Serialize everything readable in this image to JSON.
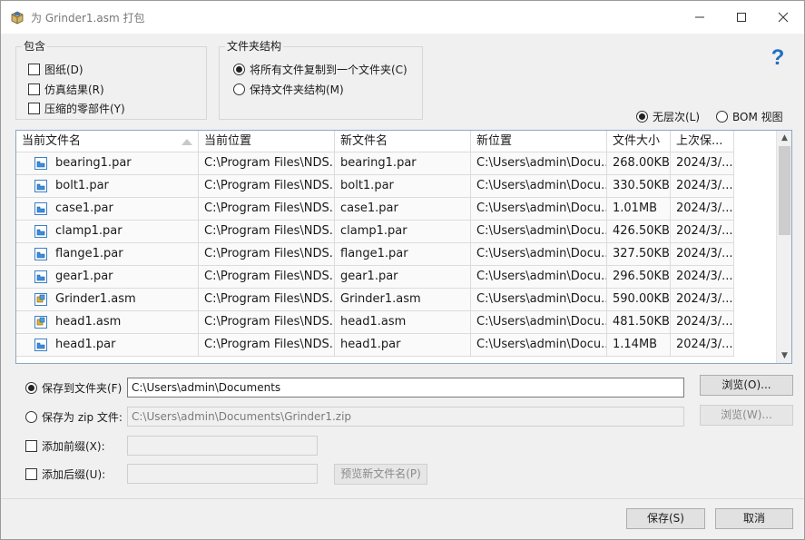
{
  "window": {
    "title": "为 Grinder1.asm 打包",
    "controls": {
      "minimize": "minimize-icon",
      "maximize": "maximize-icon",
      "close": "close-icon"
    }
  },
  "include": {
    "title": "包含",
    "options": [
      {
        "label": "图纸(D)",
        "checked": false
      },
      {
        "label": "仿真结果(R)",
        "checked": false
      },
      {
        "label": "压缩的零部件(Y)",
        "checked": false
      }
    ]
  },
  "folder_structure": {
    "title": "文件夹结构",
    "options": [
      {
        "label": "将所有文件复制到一个文件夹(C)",
        "selected": true
      },
      {
        "label": "保持文件夹结构(M)",
        "selected": false
      }
    ]
  },
  "view_mode": {
    "options": [
      {
        "label": "无层次(L)",
        "selected": true
      },
      {
        "label": "BOM 视图",
        "selected": false
      }
    ]
  },
  "table": {
    "columns": [
      "当前文件名",
      "当前位置",
      "新文件名",
      "新位置",
      "文件大小",
      "上次保..."
    ],
    "rows": [
      {
        "name": "bearing1.par",
        "type": "part",
        "location": "C:\\Program Files\\NDS...",
        "new_name": "bearing1.par",
        "new_location": "C:\\Users\\admin\\Docu...",
        "size": "268.00KB",
        "saved": "2024/3/..."
      },
      {
        "name": "bolt1.par",
        "type": "part",
        "location": "C:\\Program Files\\NDS...",
        "new_name": "bolt1.par",
        "new_location": "C:\\Users\\admin\\Docu...",
        "size": "330.50KB",
        "saved": "2024/3/..."
      },
      {
        "name": "case1.par",
        "type": "part",
        "location": "C:\\Program Files\\NDS...",
        "new_name": "case1.par",
        "new_location": "C:\\Users\\admin\\Docu...",
        "size": "1.01MB",
        "saved": "2024/3/..."
      },
      {
        "name": "clamp1.par",
        "type": "part",
        "location": "C:\\Program Files\\NDS...",
        "new_name": "clamp1.par",
        "new_location": "C:\\Users\\admin\\Docu...",
        "size": "426.50KB",
        "saved": "2024/3/..."
      },
      {
        "name": "flange1.par",
        "type": "part",
        "location": "C:\\Program Files\\NDS...",
        "new_name": "flange1.par",
        "new_location": "C:\\Users\\admin\\Docu...",
        "size": "327.50KB",
        "saved": "2024/3/..."
      },
      {
        "name": "gear1.par",
        "type": "part",
        "location": "C:\\Program Files\\NDS...",
        "new_name": "gear1.par",
        "new_location": "C:\\Users\\admin\\Docu...",
        "size": "296.50KB",
        "saved": "2024/3/..."
      },
      {
        "name": "Grinder1.asm",
        "type": "assembly",
        "location": "C:\\Program Files\\NDS...",
        "new_name": "Grinder1.asm",
        "new_location": "C:\\Users\\admin\\Docu...",
        "size": "590.00KB",
        "saved": "2024/3/..."
      },
      {
        "name": "head1.asm",
        "type": "assembly",
        "location": "C:\\Program Files\\NDS...",
        "new_name": "head1.asm",
        "new_location": "C:\\Users\\admin\\Docu...",
        "size": "481.50KB",
        "saved": "2024/3/..."
      },
      {
        "name": "head1.par",
        "type": "part",
        "location": "C:\\Program Files\\NDS...",
        "new_name": "head1.par",
        "new_location": "C:\\Users\\admin\\Docu...",
        "size": "1.14MB",
        "saved": "2024/3/..."
      }
    ]
  },
  "save_to_folder": {
    "label": "保存到文件夹(F)",
    "selected": true,
    "value": "C:\\Users\\admin\\Documents",
    "browse": "浏览(O)..."
  },
  "save_as_zip": {
    "label": "保存为 zip 文件:",
    "selected": false,
    "value": "C:\\Users\\admin\\Documents\\Grinder1.zip",
    "browse": "浏览(W)..."
  },
  "prefix": {
    "label": "添加前缀(X):",
    "checked": false,
    "value": ""
  },
  "suffix": {
    "label": "添加后缀(U):",
    "checked": false,
    "value": ""
  },
  "preview_button": "预览新文件名(P)",
  "footer": {
    "save": "保存(S)",
    "cancel": "取消"
  }
}
